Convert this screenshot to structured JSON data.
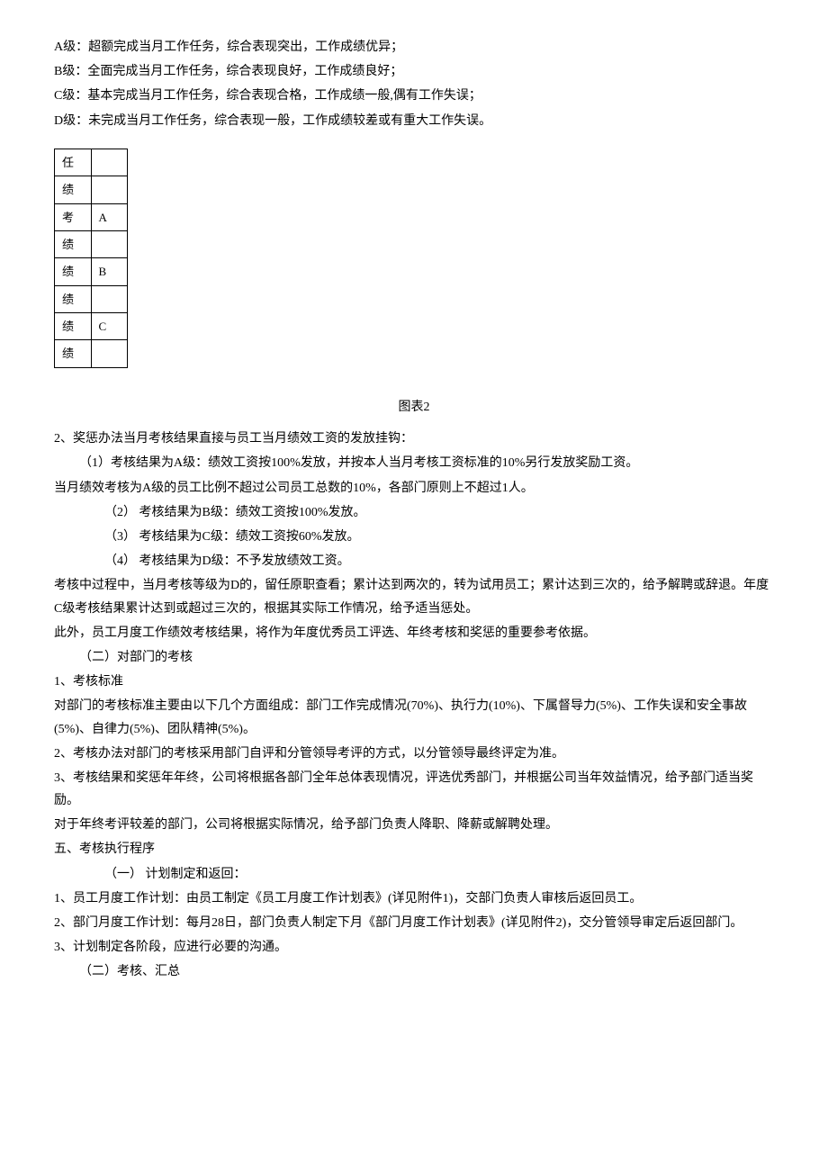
{
  "grades": [
    {
      "label": "A级：超额完成当月工作任务，综合表现突出，工作成绩优异；"
    },
    {
      "label": "B级：全面完成当月工作任务，综合表现良好，工作成绩良好；"
    },
    {
      "label": "C级：基本完成当月工作任务，综合表现合格，工作成绩一般,偶有工作失误；"
    },
    {
      "label": "D级：未完成当月工作任务，综合表现一般，工作成绩较差或有重大工作失误。"
    }
  ],
  "figure_caption": "图表2",
  "paragraphs": [
    {
      "id": "p1",
      "text": "2、奖惩办法当月考核结果直接与员工当月绩效工资的发放挂钩："
    },
    {
      "id": "p2",
      "text": "（1）考核结果为A级：绩效工资按100%发放，并按本人当月考核工资标准的10%另行发放奖励工资。",
      "indent": 1
    },
    {
      "id": "p3",
      "text": "当月绩效考核为A级的员工比例不超过公司员工总数的10%，各部门原则上不超过1人。"
    },
    {
      "id": "p4",
      "text": "（2）  考核结果为B级：绩效工资按100%发放。",
      "indent": 2
    },
    {
      "id": "p5",
      "text": "（3）  考核结果为C级：绩效工资按60%发放。",
      "indent": 2
    },
    {
      "id": "p6",
      "text": "（4）  考核结果为D级：不予发放绩效工资。",
      "indent": 2
    },
    {
      "id": "p7",
      "text": "考核中过程中，当月考核等级为D的，留任原职查看；累计达到两次的，转为试用员工；累计达到三次的，给予解聘或辞退。年度C级考核结果累计达到或超过三次的，根据其实际工作情况，给予适当惩处。"
    },
    {
      "id": "p8",
      "text": "此外，员工月度工作绩效考核结果，将作为年度优秀员工评选、年终考核和奖惩的重要参考依据。"
    },
    {
      "id": "p9",
      "text": "（二）对部门的考核",
      "indent": 1
    },
    {
      "id": "p10",
      "text": "1、考核标准"
    },
    {
      "id": "p11",
      "text": "对部门的考核标准主要由以下几个方面组成：部门工作完成情况(70%)、执行力(10%)、下属督导力(5%)、工作失误和安全事故(5%)、自律力(5%)、团队精神(5%)。"
    },
    {
      "id": "p12",
      "text": "2、考核办法对部门的考核采用部门自评和分管领导考评的方式，以分管领导最终评定为准。"
    },
    {
      "id": "p13",
      "text": "3、考核结果和奖惩年年终，公司将根据各部门全年总体表现情况，评选优秀部门，并根据公司当年效益情况，给予部门适当奖励。"
    },
    {
      "id": "p14",
      "text": "对于年终考评较差的部门，公司将根据实际情况，给予部门负责人降职、降薪或解聘处理。"
    },
    {
      "id": "p15",
      "text": "五、考核执行程序"
    },
    {
      "id": "p16",
      "text": "（一）    计划制定和返回：",
      "indent": 2
    },
    {
      "id": "p17",
      "text": "1、员工月度工作计划：由员工制定《员工月度工作计划表》(详见附件1)，交部门负责人审核后返回员工。"
    },
    {
      "id": "p18",
      "text": "2、部门月度工作计划：每月28日，部门负责人制定下月《部门月度工作计划表》(详见附件2)，交分管领导审定后返回部门。"
    },
    {
      "id": "p19",
      "text": "3、计划制定各阶段，应进行必要的沟通。"
    },
    {
      "id": "p20",
      "text": "（二）考核、汇总",
      "indent": 1
    }
  ],
  "table": {
    "rows": [
      [
        "任",
        ""
      ],
      [
        "绩",
        ""
      ],
      [
        "考",
        "A"
      ],
      [
        "绩",
        ""
      ],
      [
        "绩",
        "B"
      ],
      [
        "绩",
        ""
      ],
      [
        "绩",
        "C"
      ],
      [
        "绩",
        ""
      ]
    ]
  }
}
